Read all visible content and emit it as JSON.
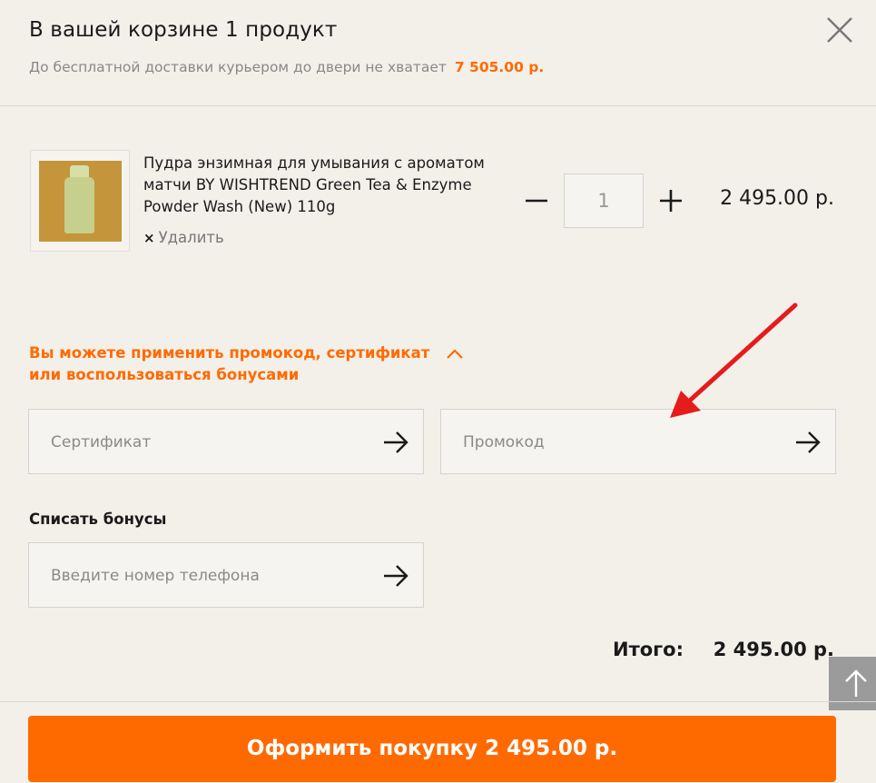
{
  "cart": {
    "title": "В вашей корзине 1 продукт",
    "shipping_note": "До бесплатной доставки курьером до двери не хватает",
    "shipping_amount": "7 505.00 р."
  },
  "item": {
    "name": "Пудра энзимная для умывания с ароматом матчи BY WISHTREND Green Tea & Enzyme Powder Wash (New) 110g",
    "remove_label": "Удалить",
    "remove_icon": "×",
    "quantity": "1",
    "price": "2 495.00 р."
  },
  "promo": {
    "toggle_label": "Вы можете применить промокод, сертификат или воспользоваться бонусами",
    "certificate_placeholder": "Сертификат",
    "promocode_placeholder": "Промокод"
  },
  "bonus": {
    "label": "Списать бонусы",
    "phone_placeholder": "Введите номер телефона"
  },
  "total": {
    "label": "Итого:",
    "value": "2 495.00 р."
  },
  "checkout": {
    "label": "Оформить покупку 2 495.00 р."
  },
  "colors": {
    "accent": "#ff6a00",
    "background": "#f3f0ea",
    "annotation_arrow": "#e61b1b"
  },
  "icons": {
    "close": "close-icon",
    "minus": "minus-icon",
    "plus": "plus-icon",
    "chevron": "chevron-up-icon",
    "arrow": "arrow-right-icon",
    "scroll": "arrow-up-icon"
  }
}
